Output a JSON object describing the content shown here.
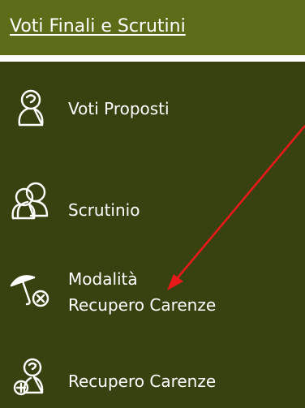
{
  "header": {
    "title": "Voti Finali e Scrutini"
  },
  "menu": {
    "items": [
      {
        "label": "Voti Proposti",
        "icon": "person-icon"
      },
      {
        "label": "Scrutinio",
        "icon": "people-group-icon"
      },
      {
        "label_line1": "Modalità",
        "label_line2": "Recupero Carenze",
        "icon": "umbrella-cancel-icon"
      },
      {
        "label": "Recupero Carenze",
        "icon": "person-add-icon"
      }
    ]
  },
  "colors": {
    "header_bg": "#5d6c19",
    "panel_bg": "#384210",
    "text": "#ffffff",
    "annotation_arrow": "#e8191a"
  }
}
